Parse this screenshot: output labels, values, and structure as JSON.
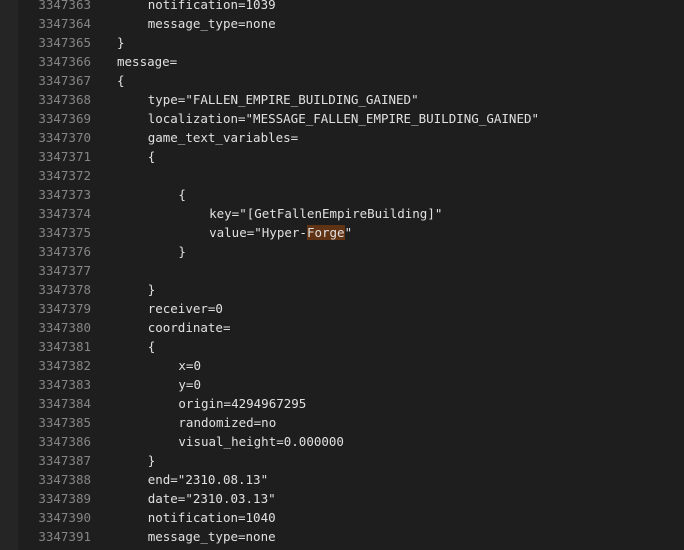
{
  "editor": {
    "lines": [
      {
        "num": "3347363",
        "indent": 1,
        "parts": [
          {
            "text": "notification=1039"
          }
        ]
      },
      {
        "num": "3347364",
        "indent": 1,
        "parts": [
          {
            "text": "message_type=none"
          }
        ]
      },
      {
        "num": "3347365",
        "indent": 0,
        "parts": [
          {
            "text": "}"
          }
        ]
      },
      {
        "num": "3347366",
        "indent": 0,
        "parts": [
          {
            "text": "message="
          }
        ]
      },
      {
        "num": "3347367",
        "indent": 0,
        "parts": [
          {
            "text": "{"
          }
        ]
      },
      {
        "num": "3347368",
        "indent": 1,
        "parts": [
          {
            "text": "type=\"FALLEN_EMPIRE_BUILDING_GAINED\""
          }
        ]
      },
      {
        "num": "3347369",
        "indent": 1,
        "parts": [
          {
            "text": "localization=\"MESSAGE_FALLEN_EMPIRE_BUILDING_GAINED\""
          }
        ]
      },
      {
        "num": "3347370",
        "indent": 1,
        "parts": [
          {
            "text": "game_text_variables="
          }
        ]
      },
      {
        "num": "3347371",
        "indent": 1,
        "parts": [
          {
            "text": "{"
          }
        ]
      },
      {
        "num": "3347372",
        "indent": 0,
        "parts": []
      },
      {
        "num": "3347373",
        "indent": 2,
        "parts": [
          {
            "text": "{"
          }
        ]
      },
      {
        "num": "3347374",
        "indent": 3,
        "parts": [
          {
            "text": "key=\"[GetFallenEmpireBuilding]\""
          }
        ]
      },
      {
        "num": "3347375",
        "indent": 3,
        "parts": [
          {
            "text": "value=\"Hyper-"
          },
          {
            "text": "Forge",
            "highlight": true
          },
          {
            "text": "\""
          }
        ]
      },
      {
        "num": "3347376",
        "indent": 2,
        "parts": [
          {
            "text": "}"
          }
        ]
      },
      {
        "num": "3347377",
        "indent": 0,
        "parts": []
      },
      {
        "num": "3347378",
        "indent": 1,
        "parts": [
          {
            "text": "}"
          }
        ]
      },
      {
        "num": "3347379",
        "indent": 1,
        "parts": [
          {
            "text": "receiver=0"
          }
        ]
      },
      {
        "num": "3347380",
        "indent": 1,
        "parts": [
          {
            "text": "coordinate="
          }
        ]
      },
      {
        "num": "3347381",
        "indent": 1,
        "parts": [
          {
            "text": "{"
          }
        ]
      },
      {
        "num": "3347382",
        "indent": 2,
        "parts": [
          {
            "text": "x=0"
          }
        ]
      },
      {
        "num": "3347383",
        "indent": 2,
        "parts": [
          {
            "text": "y=0"
          }
        ]
      },
      {
        "num": "3347384",
        "indent": 2,
        "parts": [
          {
            "text": "origin=4294967295"
          }
        ]
      },
      {
        "num": "3347385",
        "indent": 2,
        "parts": [
          {
            "text": "randomized=no"
          }
        ]
      },
      {
        "num": "3347386",
        "indent": 2,
        "parts": [
          {
            "text": "visual_height=0.000000"
          }
        ]
      },
      {
        "num": "3347387",
        "indent": 1,
        "parts": [
          {
            "text": "}"
          }
        ]
      },
      {
        "num": "3347388",
        "indent": 1,
        "parts": [
          {
            "text": "end=\"2310.08.13\""
          }
        ]
      },
      {
        "num": "3347389",
        "indent": 1,
        "parts": [
          {
            "text": "date=\"2310.03.13\""
          }
        ]
      },
      {
        "num": "3347390",
        "indent": 1,
        "parts": [
          {
            "text": "notification=1040"
          }
        ]
      },
      {
        "num": "3347391",
        "indent": 1,
        "parts": [
          {
            "text": "message_type=none"
          }
        ]
      }
    ]
  }
}
